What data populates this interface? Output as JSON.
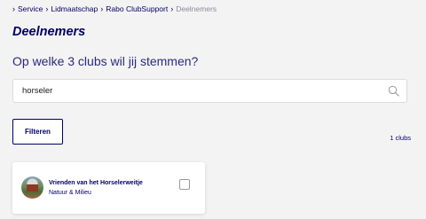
{
  "breadcrumb": {
    "items": [
      "Service",
      "Lidmaatschap",
      "Rabo ClubSupport"
    ],
    "current": "Deelnemers"
  },
  "page": {
    "title": "Deelnemers",
    "question": "Op welke 3 clubs wil jij stemmen?"
  },
  "search": {
    "value": "horseler",
    "icon": "search-icon"
  },
  "filter": {
    "button_label": "Filteren"
  },
  "results": {
    "count_label": "1 clubs"
  },
  "clubs": [
    {
      "name": "Vrienden van het Horselerweitje",
      "category": "Natuur & Milieu",
      "selected": false
    }
  ],
  "colors": {
    "brand": "#000066",
    "background": "#f3f3f3",
    "muted": "#8a8aa0"
  }
}
